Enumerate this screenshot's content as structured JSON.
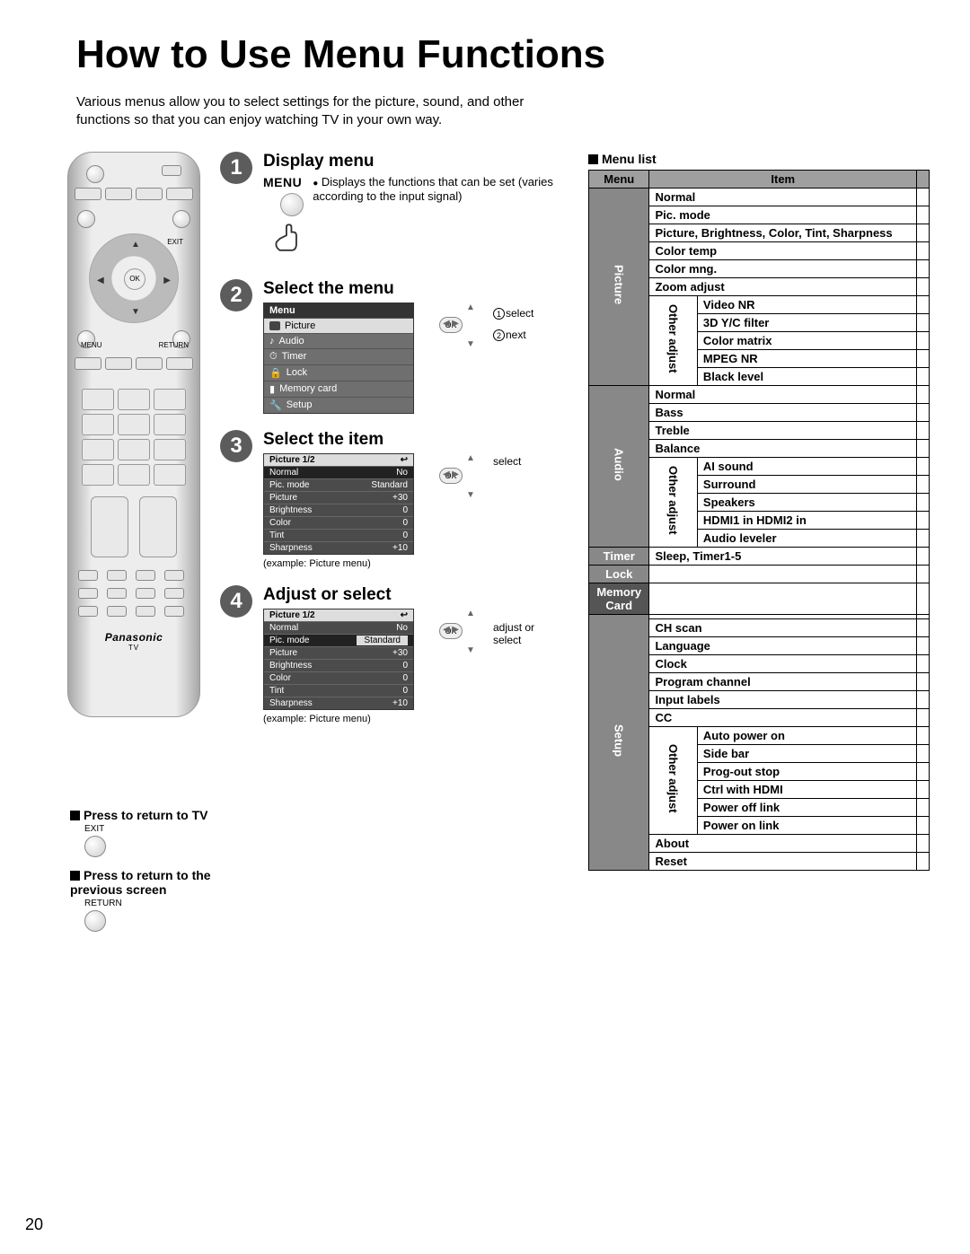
{
  "title": "How to Use Menu Functions",
  "intro": "Various menus allow you to select settings for the picture, sound, and other functions so that you can enjoy watching TV in your own way.",
  "page_number": "20",
  "remote": {
    "brand": "Panasonic",
    "tv_label": "TV",
    "exit": "EXIT",
    "menu": "MENU",
    "return": "RETURN",
    "ok": "OK"
  },
  "steps": {
    "s1": {
      "num": "1",
      "title": "Display menu",
      "menu_word": "MENU",
      "desc": "Displays the functions that can be set (varies according to the input signal)"
    },
    "s2": {
      "num": "2",
      "title": "Select the menu",
      "menu_header": "Menu",
      "items": [
        "Picture",
        "Audio",
        "Timer",
        "Lock",
        "Memory card",
        "Setup"
      ],
      "nav1": "select",
      "nav2": "next",
      "ok": "OK",
      "c1": "1",
      "c2": "2"
    },
    "s3": {
      "num": "3",
      "title": "Select the item",
      "header": "Picture   1/2",
      "rows": [
        {
          "k": "Normal",
          "v": "No"
        },
        {
          "k": "Pic. mode",
          "v": "Standard"
        },
        {
          "k": "Picture",
          "v": "+30"
        },
        {
          "k": "Brightness",
          "v": "0"
        },
        {
          "k": "Color",
          "v": "0"
        },
        {
          "k": "Tint",
          "v": "0"
        },
        {
          "k": "Sharpness",
          "v": "+10"
        }
      ],
      "caption": "(example: Picture menu)",
      "nav": "select",
      "ok": "OK"
    },
    "s4": {
      "num": "4",
      "title": "Adjust or select",
      "header": "Picture   1/2",
      "rows": [
        {
          "k": "Normal",
          "v": "No"
        },
        {
          "k": "Pic. mode",
          "v": "Standard"
        },
        {
          "k": "Picture",
          "v": "+30"
        },
        {
          "k": "Brightness",
          "v": "0"
        },
        {
          "k": "Color",
          "v": "0"
        },
        {
          "k": "Tint",
          "v": "0"
        },
        {
          "k": "Sharpness",
          "v": "+10"
        }
      ],
      "caption": "(example: Picture menu)",
      "nav": "adjust or select",
      "ok": "OK"
    }
  },
  "returns": {
    "to_tv": "Press to return to TV",
    "exit": "EXIT",
    "to_prev": "Press to return to the previous screen",
    "return": "RETURN"
  },
  "menulist": {
    "heading": "Menu list",
    "col_menu": "Menu",
    "col_item": "Item",
    "picture": {
      "label": "Picture",
      "items": [
        "Normal",
        "Pic. mode",
        "Picture, Brightness, Color, Tint, Sharpness",
        "Color temp",
        "Color mng.",
        "Zoom adjust"
      ],
      "other_label": "Other adjust",
      "other": [
        "Video NR",
        "3D Y/C filter",
        "Color matrix",
        "MPEG NR",
        "Black level"
      ]
    },
    "audio": {
      "label": "Audio",
      "items": [
        "Normal",
        "Bass",
        "Treble",
        "Balance"
      ],
      "other_label": "Other adjust",
      "other": [
        "AI sound",
        "Surround",
        "Speakers",
        "HDMI1 in HDMI2 in",
        "Audio leveler"
      ]
    },
    "timer": {
      "label": "Timer",
      "item": "Sleep, Timer1-5"
    },
    "lock": {
      "label": "Lock"
    },
    "memory": {
      "label1": "Memory",
      "label2": "Card"
    },
    "setup": {
      "label": "Setup",
      "blank_lead": " ",
      "items": [
        "CH scan",
        "Language",
        "Clock",
        "Program channel",
        "Input labels",
        "CC"
      ],
      "other_label": "Other adjust",
      "other": [
        "Auto power on",
        "Side bar",
        "Prog-out stop",
        "Ctrl with HDMI",
        "Power off link",
        "Power on link"
      ],
      "tail": [
        "About",
        "Reset"
      ]
    }
  }
}
